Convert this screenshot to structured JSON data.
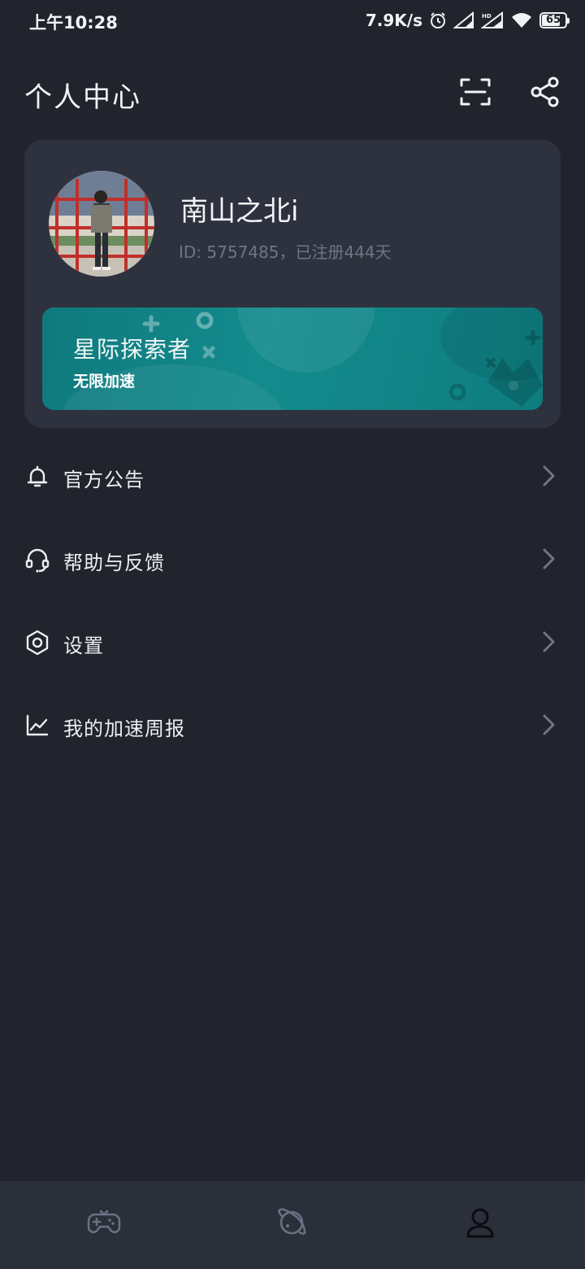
{
  "status_bar": {
    "time": "上午10:28",
    "net_speed": "7.9K/s",
    "battery": "65",
    "icons": [
      "alarm-icon",
      "signal-icon",
      "hd-signal-icon",
      "wifi-icon",
      "battery-icon"
    ]
  },
  "header": {
    "title": "个人中心",
    "actions": [
      "scan-icon",
      "share-icon"
    ]
  },
  "profile": {
    "username": "南山之北i",
    "id_line": "ID: 5757485，已注册444天"
  },
  "membership": {
    "title": "星际探索者",
    "subtitle": "无限加速"
  },
  "menu": [
    {
      "label": "官方公告",
      "icon": "bell-icon"
    },
    {
      "label": "帮助与反馈",
      "icon": "headset-icon"
    },
    {
      "label": "设置",
      "icon": "settings-icon"
    },
    {
      "label": "我的加速周报",
      "icon": "chart-icon"
    }
  ],
  "bottom_nav": {
    "items": [
      "gamepad-icon",
      "planet-icon",
      "user-icon"
    ],
    "active": "user-icon"
  },
  "colors": {
    "background": "#21242d",
    "card": "#2e323e",
    "banner": "#12868a",
    "text": "#eceef2",
    "muted": "#6f7584"
  }
}
